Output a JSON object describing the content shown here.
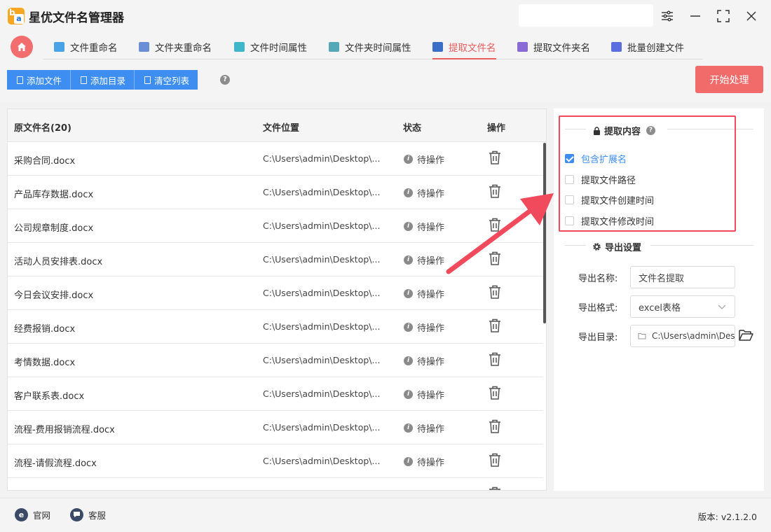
{
  "app": {
    "title": "星优文件名管理器"
  },
  "tabs": [
    {
      "label": "文件重命名",
      "icon": "file-rename-icon",
      "color": "#4aa3e6"
    },
    {
      "label": "文件夹重命名",
      "icon": "folder-rename-icon",
      "color": "#6b8fd6"
    },
    {
      "label": "文件时间属性",
      "icon": "file-time-icon",
      "color": "#3fb6c9"
    },
    {
      "label": "文件夹时间属性",
      "icon": "folder-time-icon",
      "color": "#55a8b8"
    },
    {
      "label": "提取文件名",
      "icon": "extract-filename-icon",
      "color": "#3a6fc8",
      "active": true
    },
    {
      "label": "提取文件夹名",
      "icon": "extract-foldername-icon",
      "color": "#8a6ad4"
    },
    {
      "label": "批量创建文件",
      "icon": "batch-create-icon",
      "color": "#5b6ee0"
    }
  ],
  "toolbar": {
    "add_file": "添加文件",
    "add_dir": "添加目录",
    "clear_list": "清空列表",
    "help": "?",
    "start": "开始处理"
  },
  "table": {
    "headers": {
      "name": "原文件名(20)",
      "path": "文件位置",
      "status": "状态",
      "action": "操作"
    },
    "rows": [
      {
        "name": "采购合同.docx",
        "path": "C:\\Users\\admin\\Desktop\\...",
        "status": "待操作"
      },
      {
        "name": "产品库存数据.docx",
        "path": "C:\\Users\\admin\\Desktop\\...",
        "status": "待操作"
      },
      {
        "name": "公司规章制度.docx",
        "path": "C:\\Users\\admin\\Desktop\\...",
        "status": "待操作"
      },
      {
        "name": "活动人员安排表.docx",
        "path": "C:\\Users\\admin\\Desktop\\...",
        "status": "待操作"
      },
      {
        "name": "今日会议安排.docx",
        "path": "C:\\Users\\admin\\Desktop\\...",
        "status": "待操作"
      },
      {
        "name": "经费报销.docx",
        "path": "C:\\Users\\admin\\Desktop\\...",
        "status": "待操作"
      },
      {
        "name": "考情数据.docx",
        "path": "C:\\Users\\admin\\Desktop\\...",
        "status": "待操作"
      },
      {
        "name": "客户联系表.docx",
        "path": "C:\\Users\\admin\\Desktop\\...",
        "status": "待操作"
      },
      {
        "name": "流程-费用报销流程.docx",
        "path": "C:\\Users\\admin\\Desktop\\...",
        "status": "待操作"
      },
      {
        "name": "流程-请假流程.docx",
        "path": "C:\\Users\\admin\\Desktop\\...",
        "status": "待操作"
      }
    ]
  },
  "extract": {
    "title": "提取内容",
    "options": [
      {
        "label": "包含扩展名",
        "checked": true
      },
      {
        "label": "提取文件路径",
        "checked": false
      },
      {
        "label": "提取文件创建时间",
        "checked": false
      },
      {
        "label": "提取文件修改时间",
        "checked": false
      }
    ]
  },
  "export": {
    "title": "导出设置",
    "name_label": "导出名称:",
    "name_value": "文件名提取",
    "format_label": "导出格式:",
    "format_value": "excel表格",
    "dir_label": "导出目录:",
    "dir_value": "C:\\Users\\admin\\Desktop"
  },
  "footer": {
    "website": "官网",
    "service": "客服",
    "version": "版本: v2.1.2.0"
  },
  "colors": {
    "accent": "#3d8ef0",
    "brand": "#f26b6b",
    "highlight": "#f04a5c"
  }
}
